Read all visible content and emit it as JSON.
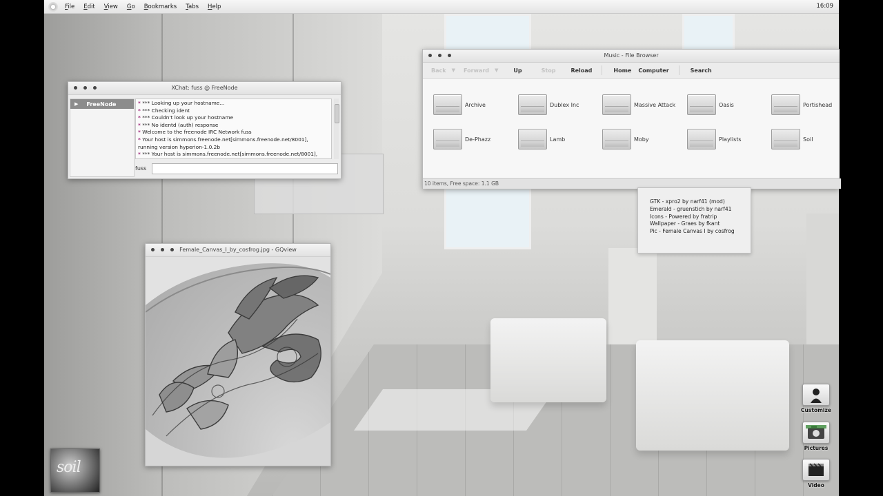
{
  "menubar": {
    "items": [
      {
        "label": "File",
        "underline": "F",
        "rest": "ile"
      },
      {
        "label": "Edit",
        "underline": "E",
        "rest": "dit"
      },
      {
        "label": "View",
        "underline": "V",
        "rest": "iew"
      },
      {
        "label": "Go",
        "underline": "G",
        "rest": "o"
      },
      {
        "label": "Bookmarks",
        "underline": "B",
        "rest": "ookmarks"
      },
      {
        "label": "Tabs",
        "underline": "T",
        "rest": "abs"
      },
      {
        "label": "Help",
        "underline": "H",
        "rest": "elp"
      }
    ],
    "clock": "16:09"
  },
  "xchat": {
    "title": "XChat: fuss @ FreeNode",
    "network": "FreeNode",
    "log": [
      {
        "star": "*",
        "text": " *** Looking up your hostname..."
      },
      {
        "star": "*",
        "text": " *** Checking ident"
      },
      {
        "star": "*",
        "text": " *** Couldn't look up your hostname"
      },
      {
        "star": "*",
        "text": " *** No identd (auth) response"
      },
      {
        "star": "*",
        "text": " Welcome to the freenode IRC Network fuss"
      },
      {
        "star": "*",
        "text": " Your host is simmons.freenode.net[simmons.freenode.net/8001],"
      },
      {
        "star": "",
        "text": " running version hyperion-1.0.2b"
      },
      {
        "star": "*",
        "text": " *** Your host is simmons.freenode.net[simmons.freenode.net/8001],"
      }
    ],
    "nick": "fuss",
    "input_value": ""
  },
  "filebrowser": {
    "title": "Music - File Browser",
    "toolbar": {
      "back": "Back",
      "forward": "Forward",
      "up": "Up",
      "stop": "Stop",
      "reload": "Reload",
      "home": "Home",
      "computer": "Computer",
      "search": "Search"
    },
    "folders": [
      "Archive",
      "Dublex Inc",
      "Massive Attack",
      "Oasis",
      "Portishead",
      "De-Phazz",
      "Lamb",
      "Moby",
      "Playlists",
      "Soil"
    ],
    "status": "10 items, Free space: 1.1 GB"
  },
  "credits": {
    "lines": [
      "GTK - xpro2 by narf41 (mod)",
      "Emerald - gruenstich by narf41",
      "Icons - Powered by fratrip",
      "Wallpaper - Graes by fkant",
      "Pic - Female Canvas I by cosfrog"
    ]
  },
  "gqview": {
    "title": "Female_Canvas_I_by_cosfrog.jpg - GQview"
  },
  "dock": {
    "customize": "Customize",
    "pictures": "Pictures",
    "video": "Video"
  },
  "album": {
    "text": "soil"
  }
}
